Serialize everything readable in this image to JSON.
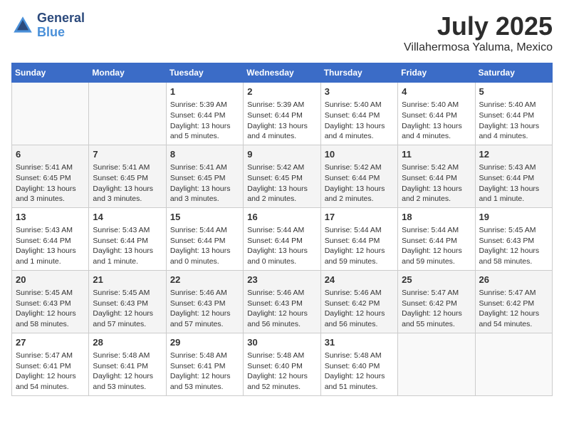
{
  "header": {
    "logo_line1": "General",
    "logo_line2": "Blue",
    "title": "July 2025",
    "subtitle": "Villahermosa Yaluma, Mexico"
  },
  "weekdays": [
    "Sunday",
    "Monday",
    "Tuesday",
    "Wednesday",
    "Thursday",
    "Friday",
    "Saturday"
  ],
  "weeks": [
    [
      {
        "day": "",
        "info": ""
      },
      {
        "day": "",
        "info": ""
      },
      {
        "day": "1",
        "info": "Sunrise: 5:39 AM\nSunset: 6:44 PM\nDaylight: 13 hours and 5 minutes."
      },
      {
        "day": "2",
        "info": "Sunrise: 5:39 AM\nSunset: 6:44 PM\nDaylight: 13 hours and 4 minutes."
      },
      {
        "day": "3",
        "info": "Sunrise: 5:40 AM\nSunset: 6:44 PM\nDaylight: 13 hours and 4 minutes."
      },
      {
        "day": "4",
        "info": "Sunrise: 5:40 AM\nSunset: 6:44 PM\nDaylight: 13 hours and 4 minutes."
      },
      {
        "day": "5",
        "info": "Sunrise: 5:40 AM\nSunset: 6:44 PM\nDaylight: 13 hours and 4 minutes."
      }
    ],
    [
      {
        "day": "6",
        "info": "Sunrise: 5:41 AM\nSunset: 6:45 PM\nDaylight: 13 hours and 3 minutes."
      },
      {
        "day": "7",
        "info": "Sunrise: 5:41 AM\nSunset: 6:45 PM\nDaylight: 13 hours and 3 minutes."
      },
      {
        "day": "8",
        "info": "Sunrise: 5:41 AM\nSunset: 6:45 PM\nDaylight: 13 hours and 3 minutes."
      },
      {
        "day": "9",
        "info": "Sunrise: 5:42 AM\nSunset: 6:45 PM\nDaylight: 13 hours and 2 minutes."
      },
      {
        "day": "10",
        "info": "Sunrise: 5:42 AM\nSunset: 6:44 PM\nDaylight: 13 hours and 2 minutes."
      },
      {
        "day": "11",
        "info": "Sunrise: 5:42 AM\nSunset: 6:44 PM\nDaylight: 13 hours and 2 minutes."
      },
      {
        "day": "12",
        "info": "Sunrise: 5:43 AM\nSunset: 6:44 PM\nDaylight: 13 hours and 1 minute."
      }
    ],
    [
      {
        "day": "13",
        "info": "Sunrise: 5:43 AM\nSunset: 6:44 PM\nDaylight: 13 hours and 1 minute."
      },
      {
        "day": "14",
        "info": "Sunrise: 5:43 AM\nSunset: 6:44 PM\nDaylight: 13 hours and 1 minute."
      },
      {
        "day": "15",
        "info": "Sunrise: 5:44 AM\nSunset: 6:44 PM\nDaylight: 13 hours and 0 minutes."
      },
      {
        "day": "16",
        "info": "Sunrise: 5:44 AM\nSunset: 6:44 PM\nDaylight: 13 hours and 0 minutes."
      },
      {
        "day": "17",
        "info": "Sunrise: 5:44 AM\nSunset: 6:44 PM\nDaylight: 12 hours and 59 minutes."
      },
      {
        "day": "18",
        "info": "Sunrise: 5:44 AM\nSunset: 6:44 PM\nDaylight: 12 hours and 59 minutes."
      },
      {
        "day": "19",
        "info": "Sunrise: 5:45 AM\nSunset: 6:43 PM\nDaylight: 12 hours and 58 minutes."
      }
    ],
    [
      {
        "day": "20",
        "info": "Sunrise: 5:45 AM\nSunset: 6:43 PM\nDaylight: 12 hours and 58 minutes."
      },
      {
        "day": "21",
        "info": "Sunrise: 5:45 AM\nSunset: 6:43 PM\nDaylight: 12 hours and 57 minutes."
      },
      {
        "day": "22",
        "info": "Sunrise: 5:46 AM\nSunset: 6:43 PM\nDaylight: 12 hours and 57 minutes."
      },
      {
        "day": "23",
        "info": "Sunrise: 5:46 AM\nSunset: 6:43 PM\nDaylight: 12 hours and 56 minutes."
      },
      {
        "day": "24",
        "info": "Sunrise: 5:46 AM\nSunset: 6:42 PM\nDaylight: 12 hours and 56 minutes."
      },
      {
        "day": "25",
        "info": "Sunrise: 5:47 AM\nSunset: 6:42 PM\nDaylight: 12 hours and 55 minutes."
      },
      {
        "day": "26",
        "info": "Sunrise: 5:47 AM\nSunset: 6:42 PM\nDaylight: 12 hours and 54 minutes."
      }
    ],
    [
      {
        "day": "27",
        "info": "Sunrise: 5:47 AM\nSunset: 6:41 PM\nDaylight: 12 hours and 54 minutes."
      },
      {
        "day": "28",
        "info": "Sunrise: 5:48 AM\nSunset: 6:41 PM\nDaylight: 12 hours and 53 minutes."
      },
      {
        "day": "29",
        "info": "Sunrise: 5:48 AM\nSunset: 6:41 PM\nDaylight: 12 hours and 53 minutes."
      },
      {
        "day": "30",
        "info": "Sunrise: 5:48 AM\nSunset: 6:40 PM\nDaylight: 12 hours and 52 minutes."
      },
      {
        "day": "31",
        "info": "Sunrise: 5:48 AM\nSunset: 6:40 PM\nDaylight: 12 hours and 51 minutes."
      },
      {
        "day": "",
        "info": ""
      },
      {
        "day": "",
        "info": ""
      }
    ]
  ]
}
